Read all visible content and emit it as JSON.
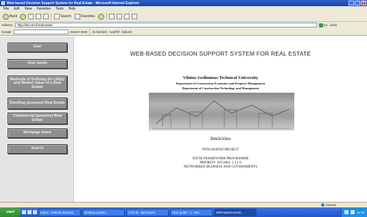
{
  "window": {
    "title": "Web-based Decision Support System for Real Estate - Microsoft Internet Explorer",
    "minimize": "_",
    "maximize": "□",
    "close": "×"
  },
  "menu": [
    "File",
    "Edit",
    "View",
    "Favorites",
    "Tools",
    "Help"
  ],
  "toolbar": {
    "back": "Back",
    "search": "Search",
    "favorites": "Favorites"
  },
  "address": {
    "label": "Address",
    "url": "http://dss.vtu.lt/realestate/",
    "go": "Go",
    "links": "Links"
  },
  "googlebar": {
    "label": "Google",
    "search_web": "Search Web",
    "blocked": "21 blocked",
    "autofill": "AutoFill",
    "options": "Options"
  },
  "sidebar": {
    "items": [
      {
        "label": "User"
      },
      {
        "label": "User Guide"
      },
      {
        "label": "Methods of Defining the Utility and Market Value of a Real Estate"
      },
      {
        "label": "Dwelling (purpose) Real Estate"
      },
      {
        "label": "Commercial (purpose) Real Estate"
      },
      {
        "label": "Mortgage loans"
      },
      {
        "label": "Search"
      }
    ]
  },
  "main": {
    "title": "WEB-BASED DECISION SUPPORT SYSTEM FOR REAL ESTATE",
    "university": "Vilnius Gediminas Technical University",
    "department1": "Department of Construction Economics and Property Management",
    "department2": "Department of Construction Technology and Management",
    "project_name": "Intelcities",
    "integrated": "INTEGRATED PROJECT",
    "framework": "SIXTH FRAMEWORK PROGRAMME",
    "priority": "PRIORITY: IST-2002- 2.3.1.9",
    "networked": "NETWORKED BUSINESS AND GOVERNMENTS"
  },
  "status": {
    "zone": "Internet"
  },
  "taskbar": {
    "start": "start",
    "tasks": [
      {
        "label": "Inbox - Outlook Express"
      },
      {
        "label": "Desktop pasisk..."
      },
      {
        "label": "CO2-M - dprinsaice"
      },
      {
        "label": "User guide - 1 - Mic..."
      },
      {
        "label": "Web-based Decisi..."
      }
    ],
    "clock": "11:15"
  },
  "colors": {
    "nav_button": "#8e8e8e",
    "sidebar_bg": "#e4e4e4",
    "title_bar": "#1a44a8"
  }
}
